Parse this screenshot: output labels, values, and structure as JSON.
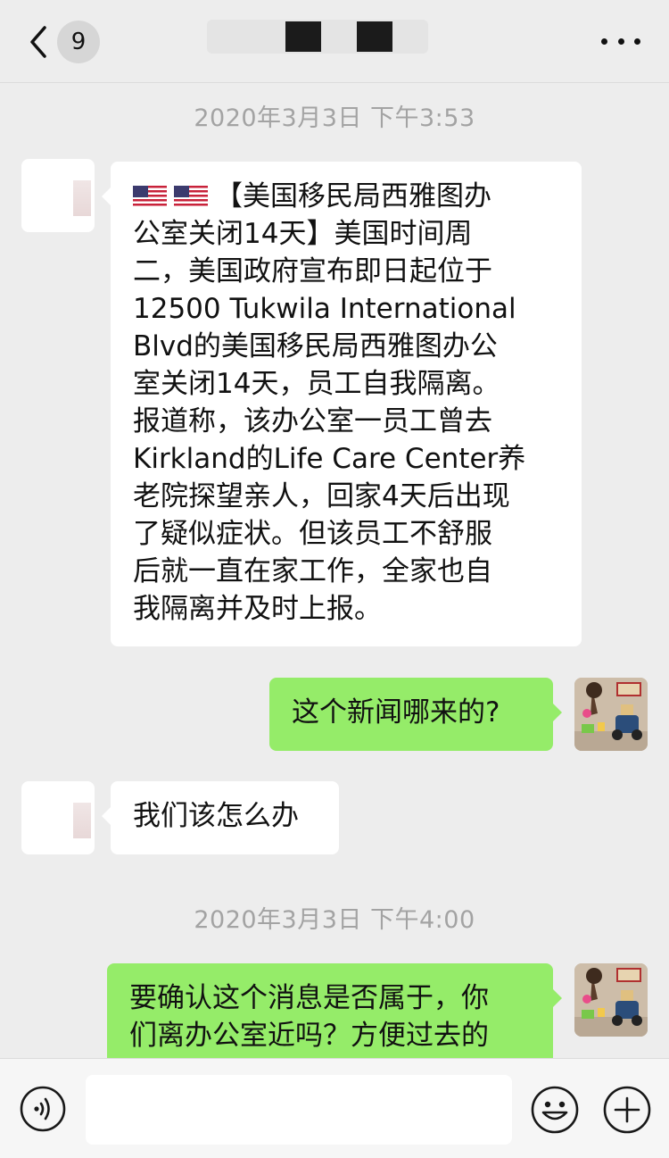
{
  "navbar": {
    "unread_count": "9",
    "icons": {
      "back": "chevron-left-icon",
      "more": "more-dots-icon"
    }
  },
  "timestamps": [
    "2020年3月3日 下午3:53",
    "2020年3月3日 下午4:00"
  ],
  "messages": [
    {
      "side": "incoming",
      "lines": [
        "【美国移民局西雅图办",
        "公室关闭14天】美国时间周",
        "二，美国政府宣布即日起位于",
        "12500 Tukwila International",
        "Blvd的美国移民局西雅图办公",
        "室关闭14天，员工自我隔离。",
        "报道称，该办公室一员工曾去",
        "Kirkland的Life Care Center养",
        "老院探望亲人，回家4天后出现",
        "了疑似症状。但该员工不舒服",
        "后就一直在家工作，全家也自",
        "我隔离并及时上报。"
      ],
      "leading_icons": [
        "us-flag-icon",
        "us-flag-icon"
      ]
    },
    {
      "side": "outgoing",
      "lines": [
        "这个新闻哪来的?"
      ]
    },
    {
      "side": "incoming",
      "lines": [
        "我们该怎么办"
      ]
    },
    {
      "side": "outgoing",
      "lines": [
        "要确认这个消息是否属于，你",
        "们离办公室近吗？方便过去的"
      ]
    }
  ],
  "input_bar": {
    "value": "",
    "icons": {
      "voice": "voice-icon",
      "emoji": "emoji-icon",
      "plus": "plus-icon"
    }
  },
  "colors": {
    "background": "#ededed",
    "incoming_bubble": "#ffffff",
    "outgoing_bubble": "#95ec69",
    "timestamp_text": "#a3a3a3"
  }
}
